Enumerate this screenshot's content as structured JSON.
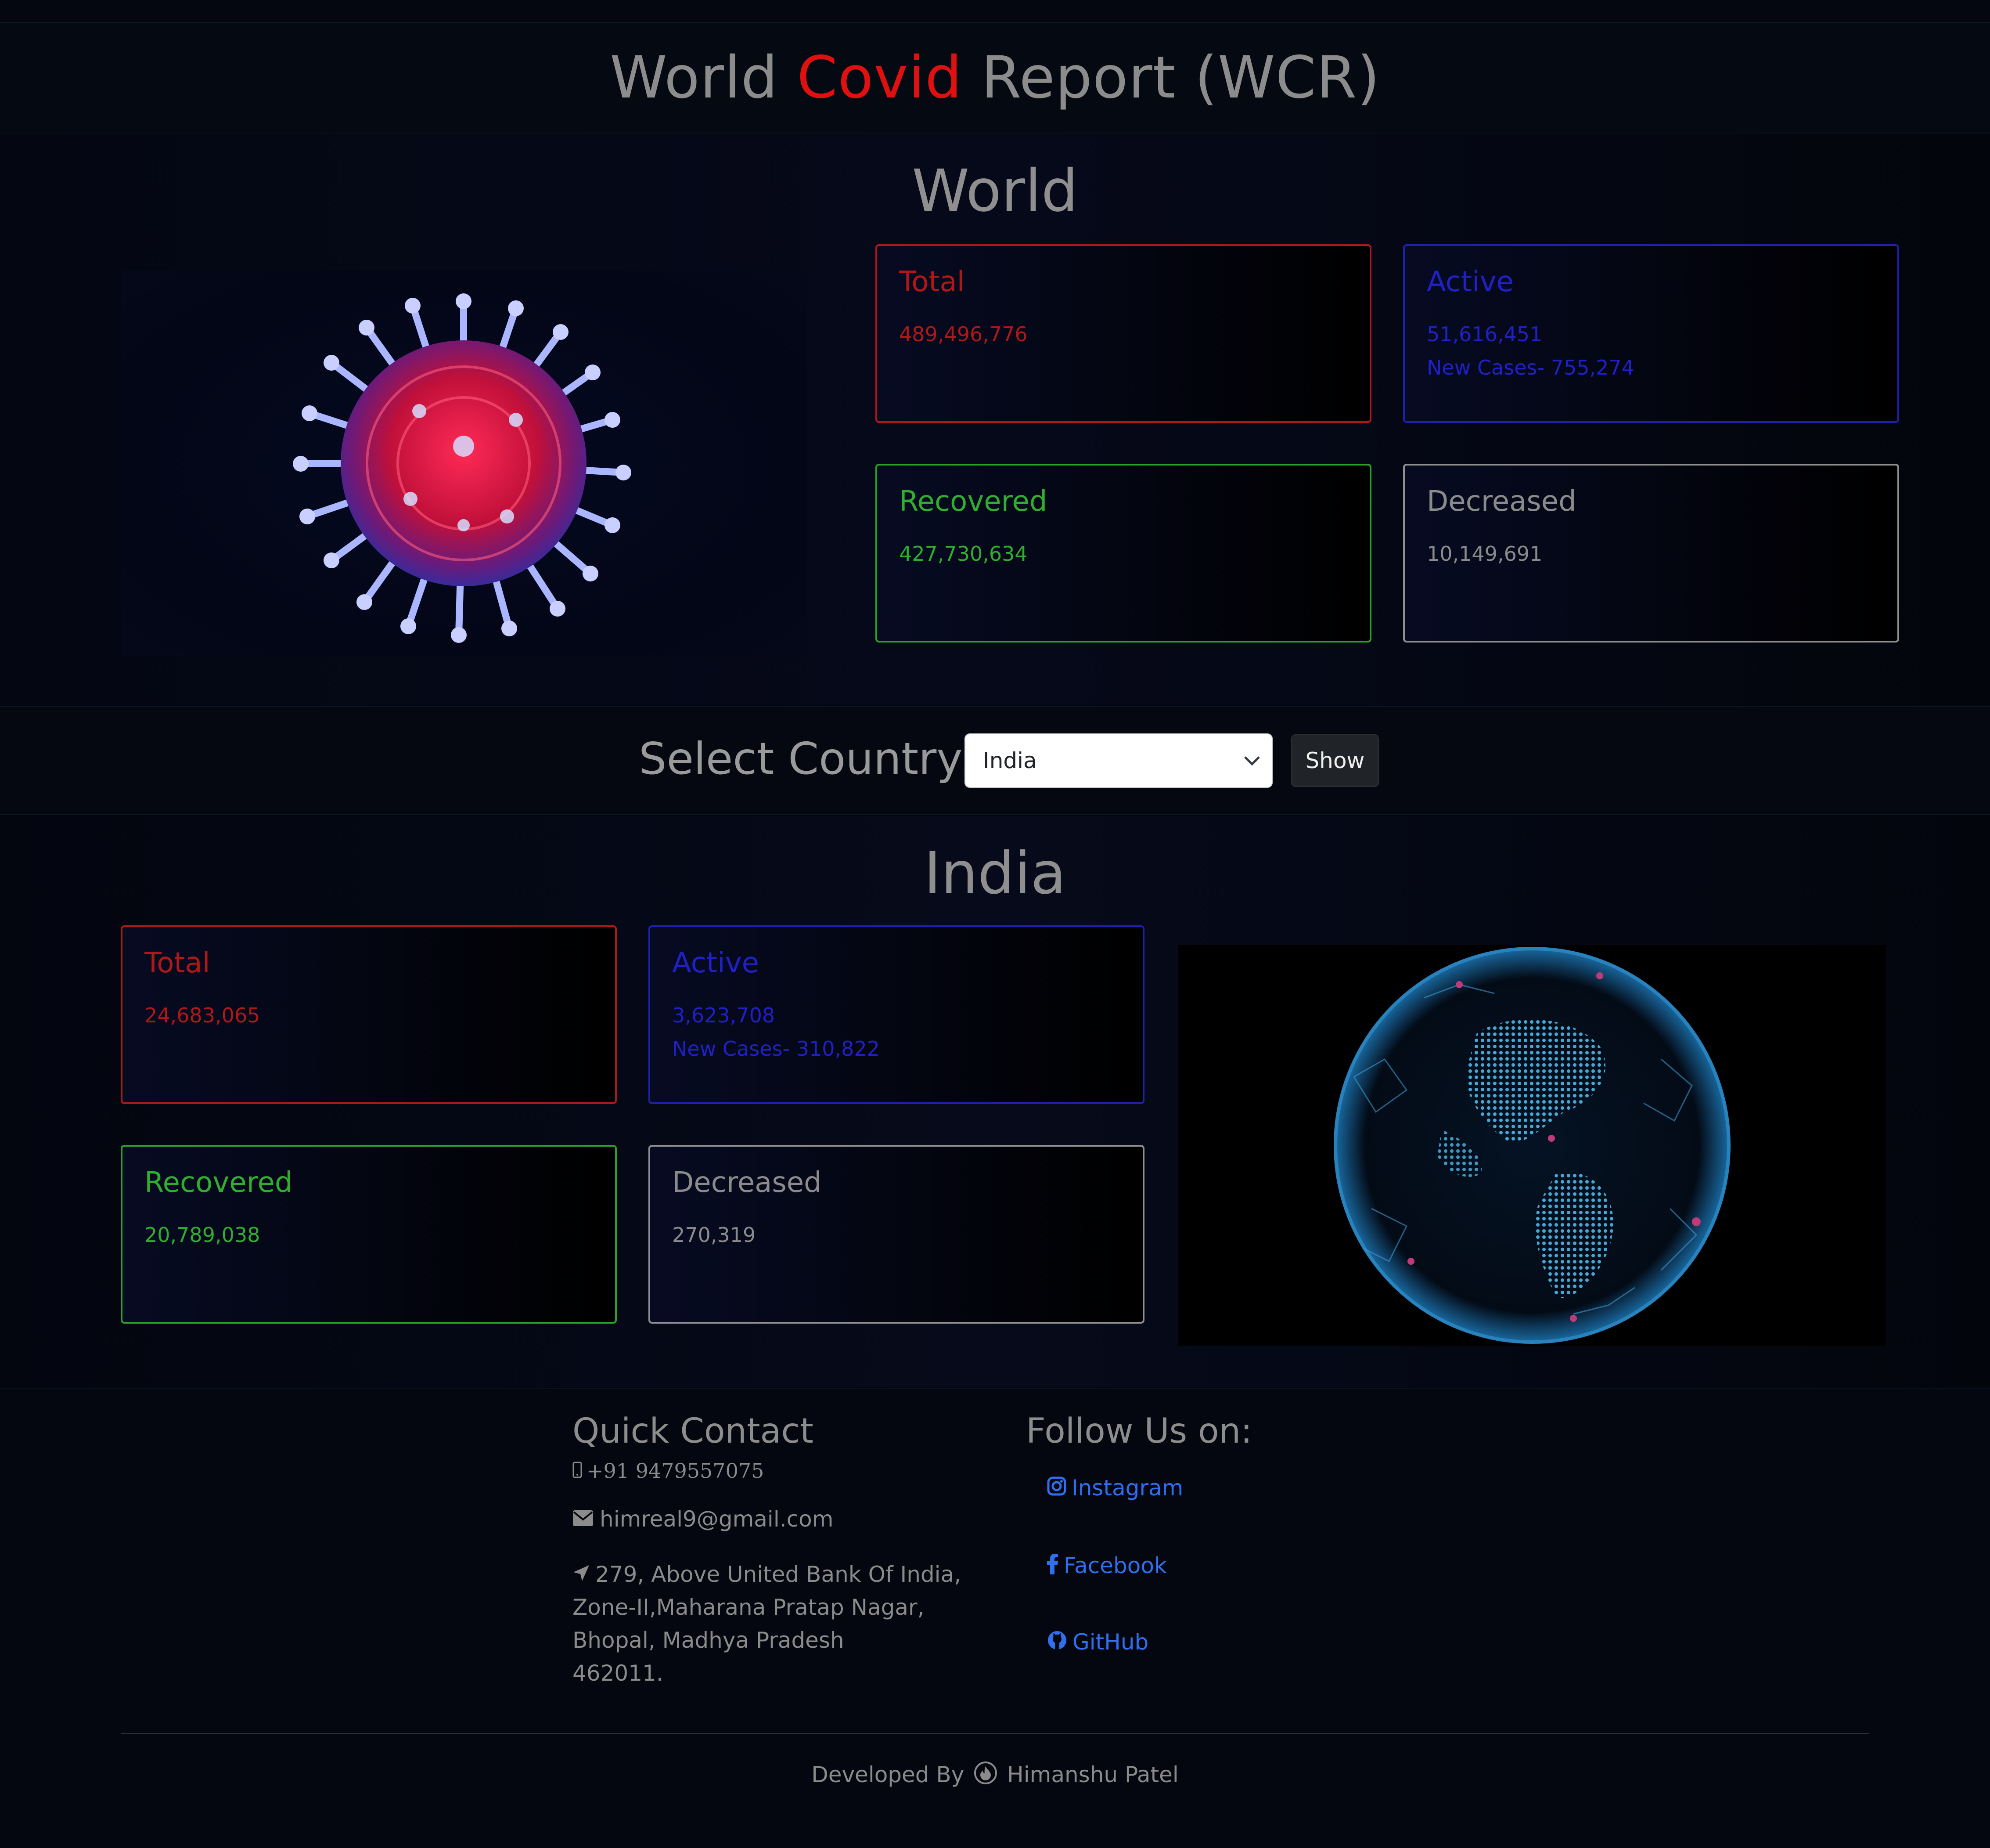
{
  "header": {
    "title_part1": "World ",
    "title_covid": "Covid",
    "title_part2": " Report (WCR)"
  },
  "world": {
    "heading": "World",
    "total": {
      "label": "Total",
      "value": "489,496,776"
    },
    "active": {
      "label": "Active",
      "value": "51,616,451",
      "new_cases": "New Cases- 755,274"
    },
    "recovered": {
      "label": "Recovered",
      "value": "427,730,634"
    },
    "decreased": {
      "label": "Decreased",
      "value": "10,149,691"
    }
  },
  "selector": {
    "label": "Select Country:",
    "selected": "India",
    "button": "Show"
  },
  "country": {
    "heading": "India",
    "total": {
      "label": "Total",
      "value": "24,683,065"
    },
    "active": {
      "label": "Active",
      "value": "3,623,708",
      "new_cases": "New Cases- 310,822"
    },
    "recovered": {
      "label": "Recovered",
      "value": "20,789,038"
    },
    "decreased": {
      "label": "Decreased",
      "value": "270,319"
    }
  },
  "footer": {
    "contact_heading": "Quick Contact",
    "phone": "+91 9479557075",
    "email": "himreal9@gmail.com",
    "address_lines": [
      "279, Above United Bank Of India,",
      "Zone-II,Maharana Pratap Nagar,",
      "Bhopal, Madhya Pradesh",
      "462011."
    ],
    "follow_heading": "Follow Us on:",
    "social": [
      {
        "label": "Instagram",
        "icon": "instagram-icon"
      },
      {
        "label": "Facebook",
        "icon": "facebook-icon"
      },
      {
        "label": "GitHub",
        "icon": "github-icon"
      }
    ],
    "credit_prefix": "Developed By",
    "credit_name": "Himanshu Patel"
  },
  "colors": {
    "accent_red": "#e01010",
    "total": "#b01818",
    "active": "#2020c6",
    "recovered": "#2fae2f",
    "decreased": "#8b8b8b",
    "link": "#2f6ff0"
  }
}
